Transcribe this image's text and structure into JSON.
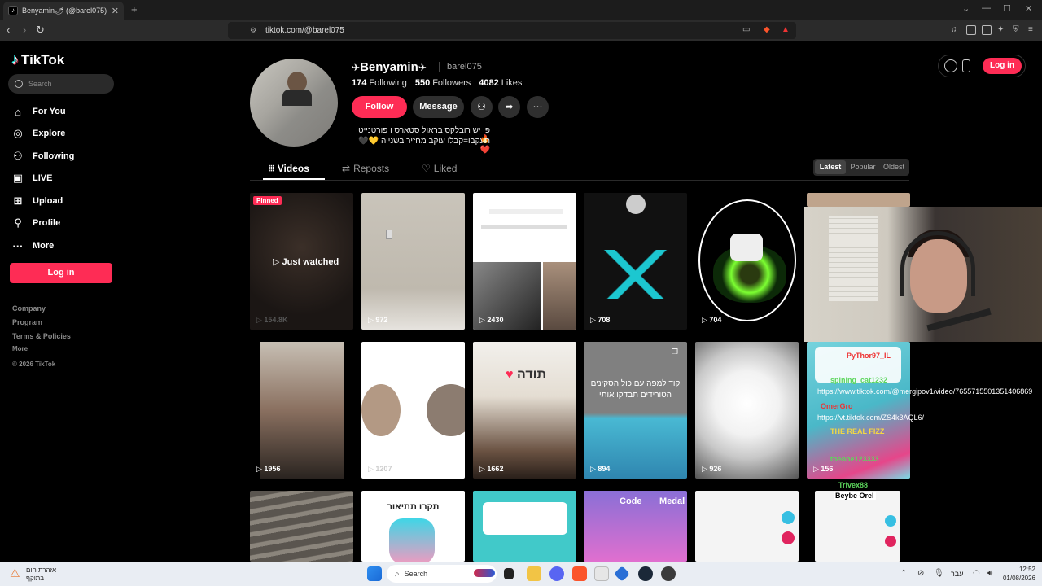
{
  "browser": {
    "tab_title": "Benyamin🌶 (@barel075) | T",
    "url": "tiktok.com/@barel075"
  },
  "sidebar": {
    "logo": "TikTok",
    "search_placeholder": "Search",
    "items": [
      {
        "label": "For You",
        "icon": "home-icon"
      },
      {
        "label": "Explore",
        "icon": "compass-icon"
      },
      {
        "label": "Following",
        "icon": "user-follow-icon"
      },
      {
        "label": "LIVE",
        "icon": "live-icon"
      },
      {
        "label": "Upload",
        "icon": "plus-square-icon"
      },
      {
        "label": "Profile",
        "icon": "user-icon"
      },
      {
        "label": "More",
        "icon": "ellipsis-icon"
      }
    ],
    "login": "Log in",
    "footer": [
      "Company",
      "Program",
      "Terms & Policies",
      "More"
    ],
    "copyright": "© 2026 TikTok"
  },
  "header": {
    "login": "Log in"
  },
  "profile": {
    "display_name": "Benyamin",
    "handle": "barel075",
    "following_count": "174",
    "following_label": "Following",
    "followers_count": "550",
    "followers_label": "Followers",
    "likes_count": "4082",
    "likes_label": "Likes",
    "follow_button": "Follow",
    "message_button": "Message",
    "bio_line1": "פו יש רובלקס בראול סטארס ו פורטנייט 🔥",
    "bio_line2": "תעקבו=קבלו עוקב מחזיר בשנייה 💛🖤❤️"
  },
  "tabs": {
    "videos": "Videos",
    "reposts": "Reposts",
    "liked": "Liked"
  },
  "sort": {
    "latest": "Latest",
    "popular": "Popular",
    "oldest": "Oldest"
  },
  "videos": [
    {
      "views": "154.8K",
      "badge": "Pinned",
      "overlay": "Just watched"
    },
    {
      "views": "972"
    },
    {
      "views": "2430"
    },
    {
      "views": "708"
    },
    {
      "views": "704"
    },
    {
      "views": ""
    },
    {
      "views": "1956"
    },
    {
      "views": "1207"
    },
    {
      "views": "1662",
      "caption": "תודה"
    },
    {
      "views": "894",
      "caption": "קוד למפה עם כול הסקינים הטורידים תבדקו אותי"
    },
    {
      "views": "926"
    },
    {
      "views": "156"
    },
    {
      "views": ""
    },
    {
      "views": "",
      "caption": "תקרו תתיאור"
    },
    {
      "views": ""
    },
    {
      "views": "",
      "caption_a": "Code",
      "caption_b": "Medal"
    },
    {
      "views": ""
    },
    {
      "views": ""
    }
  ],
  "chat": {
    "user1": "PyThor97_IL",
    "user2": "spining_cat1232",
    "link1": "https://www.tiktok.com/@mergipov1/video/7655715501351406869",
    "user3": "OmerGro",
    "link2": "https://vt.tiktok.com/ZS4k3AQL6/",
    "user4": "THE REAL FIZZ",
    "user5": "theone123333",
    "user6": "Trivex88",
    "user7": "Beybe Orel"
  },
  "taskbar": {
    "warning_line1": "אזהרת חום",
    "warning_line2": "בתוקף",
    "search": "Search",
    "lang": "עבר",
    "time": "12:52",
    "date": "01/08/2026"
  },
  "colors": {
    "accent": "#fe2c55",
    "bg": "#000000"
  }
}
